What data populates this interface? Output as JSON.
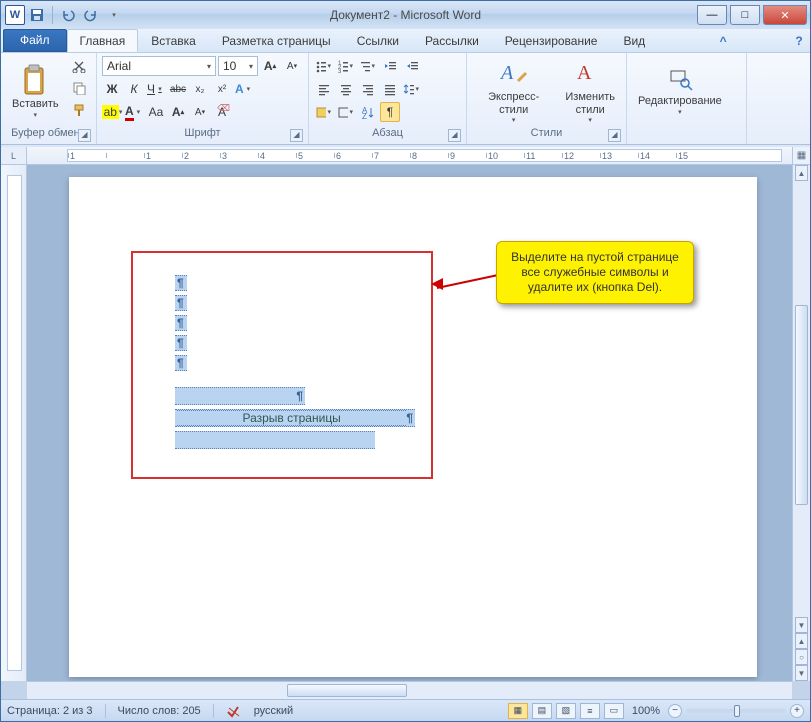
{
  "title": "Документ2 - Microsoft Word",
  "qat": {
    "word": "W"
  },
  "tabs": {
    "file": "Файл",
    "items": [
      "Главная",
      "Вставка",
      "Разметка страницы",
      "Ссылки",
      "Рассылки",
      "Рецензирование",
      "Вид"
    ],
    "active_index": 0
  },
  "ribbon": {
    "clipboard": {
      "label": "Буфер обмена",
      "paste": "Вставить"
    },
    "font": {
      "label": "Шрифт",
      "name": "Arial",
      "size": "10",
      "bold": "Ж",
      "italic": "К",
      "underline": "Ч",
      "strike": "abc",
      "sub": "x₂",
      "sup": "x²",
      "grow": "A",
      "shrink": "A",
      "changecase": "Aa",
      "clear": "A"
    },
    "paragraph": {
      "label": "Абзац",
      "pilcrow": "¶"
    },
    "styles": {
      "label": "Стили",
      "quick": "Экспресс-стили",
      "change": "Изменить\nстили"
    },
    "editing": {
      "label": "",
      "btn": "Редактирование"
    }
  },
  "ruler": {
    "ticks": [
      "1",
      "",
      "1",
      "2",
      "3",
      "4",
      "5",
      "6",
      "7",
      "8",
      "9",
      "10",
      "11",
      "12",
      "13",
      "14",
      "15"
    ]
  },
  "document": {
    "page_break_text": "Разрыв страницы",
    "pilcrow": "¶"
  },
  "callout": {
    "line1": "Выделите на пустой странице",
    "line2": "все служебные символы и",
    "line3": "удалите их (кнопка Del)."
  },
  "status": {
    "page": "Страница: 2 из 3",
    "words": "Число слов: 205",
    "lang": "русский",
    "zoom": "100%"
  }
}
